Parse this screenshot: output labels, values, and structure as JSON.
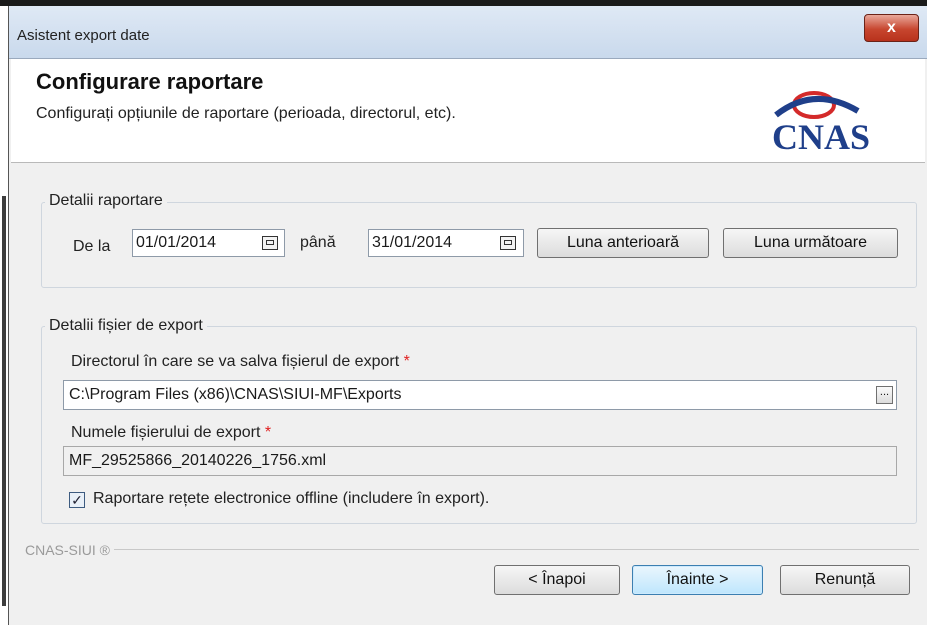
{
  "window": {
    "title": "Asistent export date",
    "close_label": "x"
  },
  "header": {
    "title": "Configurare raportare",
    "subtitle": "Configurați opțiunile de raportare (perioada, directorul, etc).",
    "logo_text": "CNAS"
  },
  "report_details": {
    "legend": "Detalii raportare",
    "from_label": "De la",
    "from_value": "01/01/2014",
    "to_label": "până",
    "to_value": "31/01/2014",
    "prev_month_button": "Luna anterioară",
    "next_month_button": "Luna următoare"
  },
  "export_file": {
    "legend": "Detalii fișier de export",
    "directory_label": "Directorul în care se va salva fișierul de export",
    "required_mark": "*",
    "directory_value": "C:\\Program Files (x86)\\CNAS\\SIUI-MF\\Exports",
    "browse_label": "...",
    "filename_label": "Numele fișierului de export",
    "filename_value": "MF_29525866_20140226_1756.xml",
    "checkbox_label": "Raportare rețete electronice offline (includere în export).",
    "checkbox_checked": true
  },
  "footer": {
    "brand": "CNAS-SIUI ®",
    "back_button": "< Înapoi",
    "next_button": "Înainte >",
    "cancel_button": "Renunță"
  },
  "colors": {
    "logo_blue": "#1f3f8a",
    "logo_red": "#d42a2a",
    "required": "#e02020",
    "close_button": "#c7462f"
  }
}
